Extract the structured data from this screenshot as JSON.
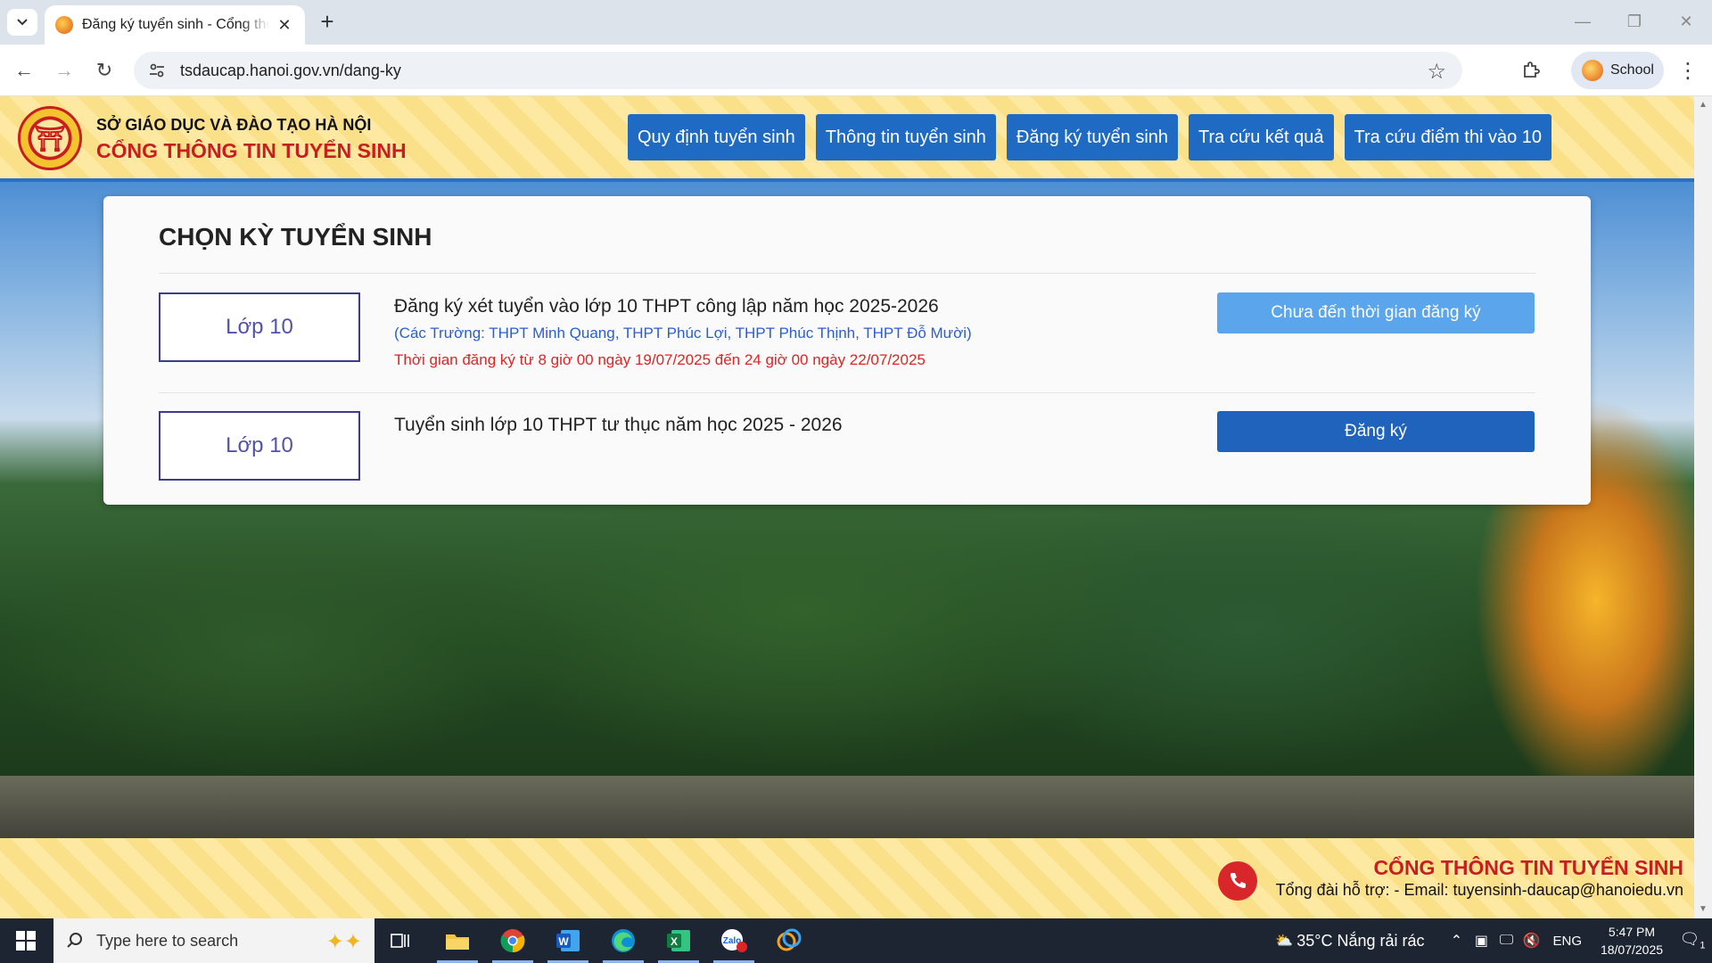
{
  "browser": {
    "tab_title": "Đăng ký tuyển sinh - Cổng thông tin tuyển sinh",
    "url": "tsdaucap.hanoi.gov.vn/dang-ky",
    "profile_name": "School"
  },
  "header": {
    "org_name": "SỞ GIÁO DỤC VÀ ĐÀO TẠO HÀ NỘI",
    "portal_name": "CỔNG THÔNG TIN TUYỂN SINH",
    "nav": [
      "Quy định tuyển sinh",
      "Thông tin tuyển sinh",
      "Đăng ký tuyển sinh",
      "Tra cứu kết quả",
      "Tra cứu điểm thi vào 10"
    ]
  },
  "card": {
    "title": "CHỌN KỲ TUYỂN SINH",
    "rows": [
      {
        "grade": "Lớp 10",
        "title": "Đăng ký xét tuyển vào lớp 10 THPT công lập năm học 2025-2026",
        "schools": "(Các Trường: THPT Minh Quang, THPT Phúc Lợi, THPT Phúc Thịnh, THPT Đỗ Mười)",
        "time": "Thời gian đăng ký từ 8 giờ 00 ngày 19/07/2025 đến 24 giờ 00 ngày 22/07/2025",
        "button": "Chưa đến thời gian đăng ký"
      },
      {
        "grade": "Lớp 10",
        "title": "Tuyển sinh lớp 10 THPT tư thục năm học 2025 - 2026",
        "button": "Đăng ký"
      }
    ]
  },
  "footer": {
    "brand": "CỔNG THÔNG TIN TUYỂN SINH",
    "contact": "Tổng đài hỗ trợ: - Email: tuyensinh-daucap@hanoiedu.vn"
  },
  "taskbar": {
    "search_placeholder": "Type here to search",
    "weather": "35°C  Nắng rải rác",
    "lang": "ENG",
    "time": "5:47 PM",
    "date": "18/07/2025",
    "notif_count": "1"
  },
  "colors": {
    "nav_blue": "#1f6ac3",
    "disabled_button": "#5aa5ec",
    "primary_button": "#1f63bd",
    "brand_red": "#c61f1f",
    "schools_blue": "#2a5fcf",
    "time_red": "#e02424"
  }
}
